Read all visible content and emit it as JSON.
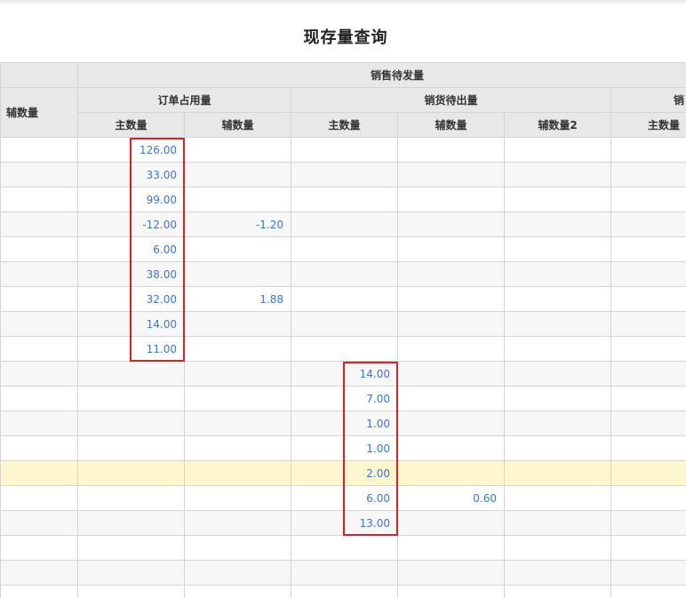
{
  "page": {
    "title": "现存量查询"
  },
  "table": {
    "header": {
      "left_aux": "辅数量",
      "sales_pending": "销售待发量",
      "order_occupied": "订单占用量",
      "sales_to_ship": "销货待出量",
      "clipped_group": "销",
      "main_qty": "主数量",
      "aux_qty": "辅数量",
      "aux_qty2": "辅数量2"
    },
    "rows": [
      {
        "cells": [
          "",
          "126.00",
          "",
          "",
          "",
          "",
          ""
        ]
      },
      {
        "cells": [
          "",
          "33.00",
          "",
          "",
          "",
          "",
          ""
        ]
      },
      {
        "cells": [
          "",
          "99.00",
          "",
          "",
          "",
          "",
          ""
        ]
      },
      {
        "cells": [
          "",
          "-12.00",
          "-1.20",
          "",
          "",
          "",
          ""
        ]
      },
      {
        "cells": [
          "",
          "6.00",
          "",
          "",
          "",
          "",
          ""
        ]
      },
      {
        "cells": [
          "",
          "38.00",
          "",
          "",
          "",
          "",
          ""
        ]
      },
      {
        "cells": [
          "",
          "32.00",
          "1.88",
          "",
          "",
          "",
          ""
        ]
      },
      {
        "cells": [
          "",
          "14.00",
          "",
          "",
          "",
          "",
          ""
        ]
      },
      {
        "cells": [
          "",
          "11.00",
          "",
          "",
          "",
          "",
          ""
        ]
      },
      {
        "cells": [
          "",
          "",
          "",
          "14.00",
          "",
          "",
          ""
        ]
      },
      {
        "cells": [
          "",
          "",
          "",
          "7.00",
          "",
          "",
          ""
        ]
      },
      {
        "cells": [
          "",
          "",
          "",
          "1.00",
          "",
          "",
          ""
        ]
      },
      {
        "cells": [
          "",
          "",
          "",
          "1.00",
          "",
          "",
          ""
        ]
      },
      {
        "cells": [
          "",
          "",
          "",
          "2.00",
          "",
          "",
          ""
        ],
        "highlight": true
      },
      {
        "cells": [
          "",
          "",
          "",
          "6.00",
          "0.60",
          "",
          ""
        ]
      },
      {
        "cells": [
          "",
          "",
          "",
          "13.00",
          "",
          "",
          ""
        ]
      },
      {
        "cells": [
          "",
          "",
          "",
          "",
          "",
          "",
          ""
        ]
      },
      {
        "cells": [
          "",
          "",
          "",
          "",
          "",
          "",
          ""
        ]
      },
      {
        "cells": [
          "",
          "",
          "",
          "",
          "",
          "",
          ""
        ]
      }
    ]
  },
  "annotations": {
    "color": "#e02020"
  }
}
